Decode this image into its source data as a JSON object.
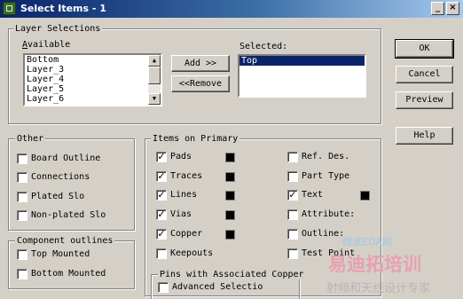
{
  "window": {
    "title": "Select Items - 1",
    "controls": [
      "_",
      "×"
    ]
  },
  "layer_selections": {
    "group_label": "Layer Selections",
    "available_label": "Available",
    "available_items": [
      "Bottom",
      "Layer_3",
      "Layer_4",
      "Layer_5",
      "Layer_6"
    ],
    "selected_label": "Selected:",
    "selected_items": [
      "Top"
    ],
    "add_button": "Add >>",
    "remove_button": "<<Remove"
  },
  "buttons": {
    "ok": "OK",
    "cancel": "Cancel",
    "preview": "Preview",
    "help": "Help"
  },
  "other": {
    "group_label": "Other",
    "items": [
      {
        "label": "Board Outline",
        "checked": false
      },
      {
        "label": "Connections",
        "checked": false
      },
      {
        "label": "Plated Slo",
        "checked": false
      },
      {
        "label": "Non-plated Slo",
        "checked": false
      }
    ]
  },
  "component_outlines": {
    "group_label": "Component outlines",
    "items": [
      {
        "label": "Top Mounted",
        "checked": false
      },
      {
        "label": "Bottom Mounted",
        "checked": false
      }
    ]
  },
  "items_on_primary": {
    "group_label": "Items on Primary",
    "left": [
      {
        "label": "Pads",
        "checked": true
      },
      {
        "label": "Traces",
        "checked": true
      },
      {
        "label": "Lines",
        "checked": true
      },
      {
        "label": "Vias",
        "checked": true
      },
      {
        "label": "Copper",
        "checked": true
      },
      {
        "label": "Keepouts",
        "checked": false
      }
    ],
    "right": [
      {
        "label": "Ref. Des.",
        "checked": false
      },
      {
        "label": "Part Type",
        "checked": false
      },
      {
        "label": "Text",
        "checked": true
      },
      {
        "label": "Attribute:",
        "checked": false
      },
      {
        "label": "Outline:",
        "checked": false
      },
      {
        "label": "Test Point",
        "checked": false
      }
    ]
  },
  "pins_copper": {
    "group_label": "Pins with Associated Copper",
    "items": [
      {
        "label": "Advanced Selectio",
        "checked": false
      }
    ]
  },
  "watermark": {
    "line1": "易迪拓培训",
    "line2": "射频和天线设计专家",
    "line3": "微波EDA网"
  },
  "colors": {
    "title_bar_start": "#0a246a",
    "title_bar_end": "#a6caf0",
    "selection": "#0a246a",
    "swatch": "#000000"
  }
}
